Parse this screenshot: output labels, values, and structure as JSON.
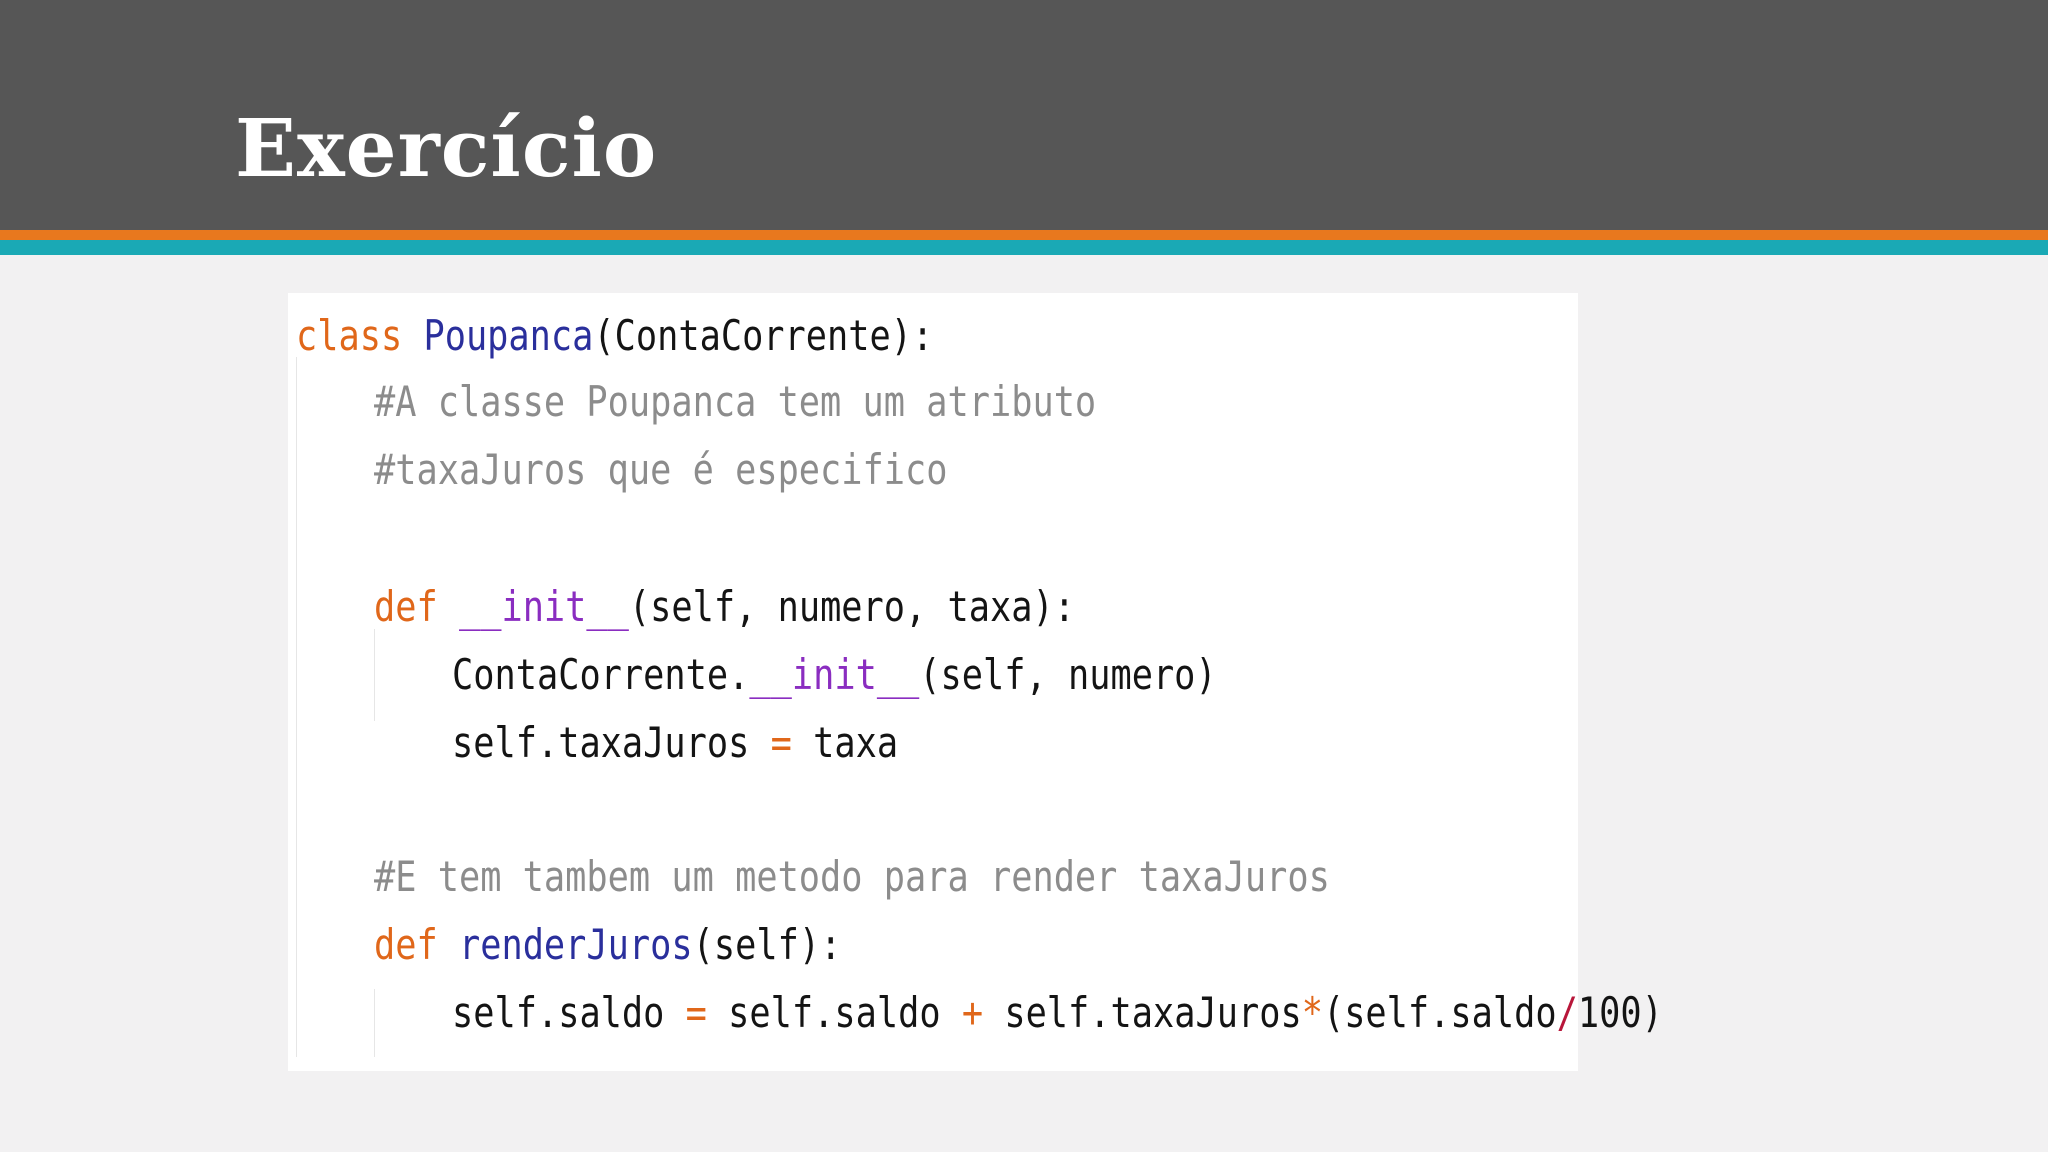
{
  "slide": {
    "title": "Exercício"
  },
  "colors": {
    "header_bg": "#565656",
    "stripe_orange": "#e8781e",
    "stripe_teal": "#1aa9b5",
    "page_bg": "#f2f1f2",
    "keyword": "#e0671a",
    "class_name": "#2a2f9c",
    "function_name": "#2a2f9c",
    "magic_method": "#8a2dc0",
    "comment": "#8c8c8c"
  },
  "code": {
    "language": "python",
    "line1": {
      "kw": "class",
      "name": "Poupanca",
      "rest": "(ContaCorrente):"
    },
    "line2": {
      "comment": "#A classe Poupanca tem um atributo"
    },
    "line3": {
      "comment": "#taxaJuros que é especifico"
    },
    "line4": {
      "kw": "def",
      "name": "__init__",
      "rest": "(self, numero, taxa):"
    },
    "line5": {
      "pre": "ContaCorrente.",
      "name": "__init__",
      "rest": "(self, numero)"
    },
    "line6": {
      "lhs": "self.taxaJuros",
      "op": "=",
      "rhs": "taxa"
    },
    "line7": {
      "comment": "#E tem tambem um metodo para render taxaJuros"
    },
    "line8": {
      "kw": "def",
      "name": "renderJuros",
      "rest": "(self):"
    },
    "line9": {
      "a": "self.saldo",
      "op1": "=",
      "b": "self.saldo",
      "op2": "+",
      "c": "self.taxaJuros",
      "op3": "*",
      "d": "(self.saldo",
      "op4": "/",
      "e": "100)"
    }
  }
}
